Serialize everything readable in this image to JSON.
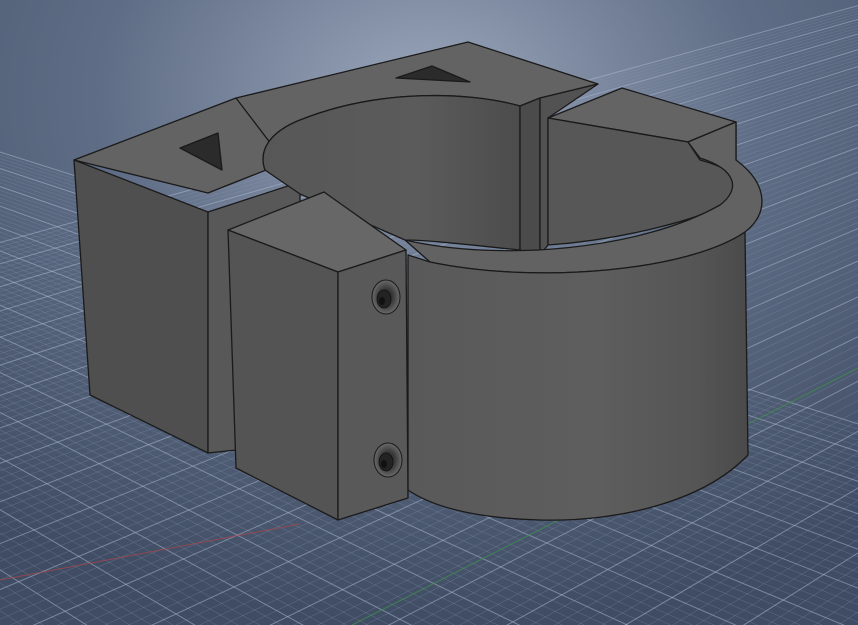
{
  "viewport": {
    "background_color": "#4d5b73",
    "grid_color": "#8a9ab3",
    "grid_major_color": "#aab8cf",
    "x_axis_color": "#b04545",
    "y_axis_color": "#3f8f4f"
  },
  "model": {
    "body_color": "#5c5c5c",
    "edge_color": "#1a1a1a",
    "icons": [
      "triangle-marker-icon",
      "countersunk-hole-icon"
    ]
  }
}
